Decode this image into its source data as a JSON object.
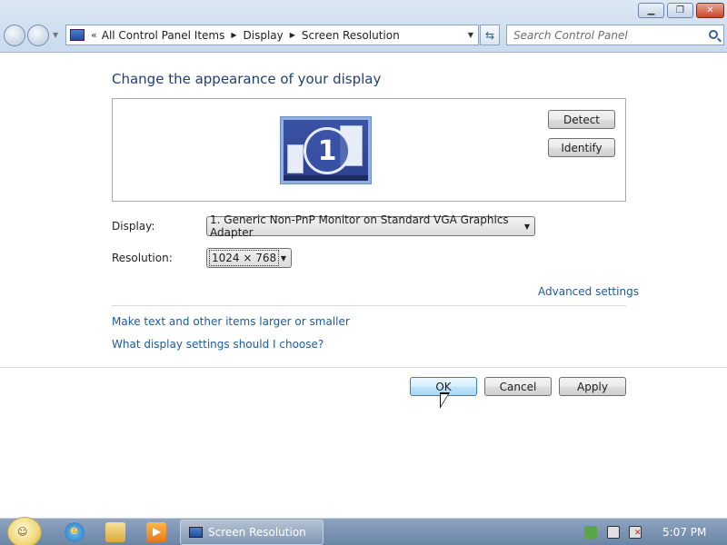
{
  "window": {
    "controls": {
      "minimize": "",
      "maximize": "",
      "close": ""
    }
  },
  "nav": {
    "breadcrumb": [
      "All Control Panel Items",
      "Display",
      "Screen Resolution"
    ],
    "search_placeholder": "Search Control Panel"
  },
  "content": {
    "heading": "Change the appearance of your display",
    "monitor_number": "1",
    "detect_label": "Detect",
    "identify_label": "Identify",
    "display_label": "Display:",
    "display_value": "1. Generic Non-PnP Monitor on Standard VGA Graphics Adapter",
    "resolution_label": "Resolution:",
    "resolution_value": "1024 × 768",
    "advanced_link": "Advanced settings",
    "text_size_link": "Make text and other items larger or smaller",
    "which_settings_link": "What display settings should I choose?"
  },
  "actions": {
    "ok": "OK",
    "cancel": "Cancel",
    "apply": "Apply"
  },
  "taskbar": {
    "active_task": "Screen Resolution",
    "clock": "5:07 PM"
  },
  "colors": {
    "link": "#1d5a9a",
    "heading": "#1e3f78",
    "ok_button": "#bee6fd",
    "taskbar": "#6b85a6"
  },
  "icons": [
    "back-icon",
    "forward-icon",
    "control-panel-icon",
    "refresh-icon",
    "search-icon",
    "monitor-icon",
    "ie-icon",
    "explorer-icon",
    "media-player-icon",
    "action-center-icon",
    "network-icon",
    "volume-muted-icon"
  ]
}
